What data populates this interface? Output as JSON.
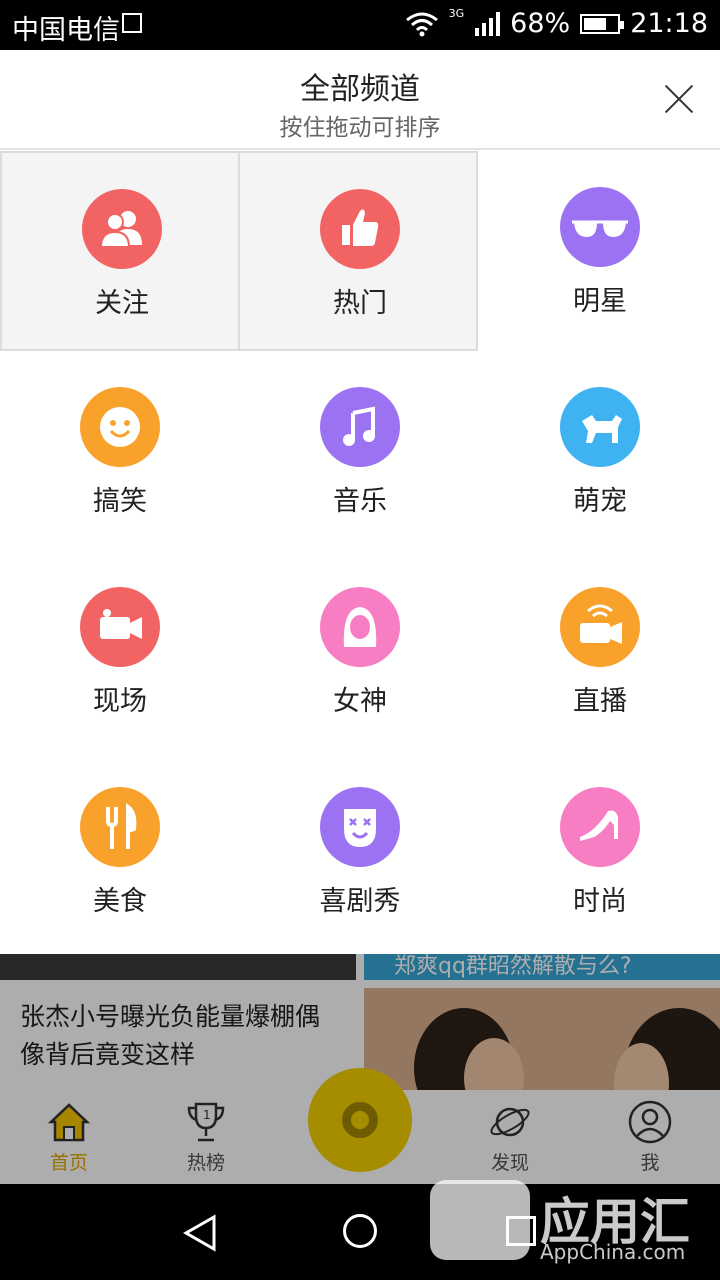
{
  "status_bar": {
    "carrier": "中国电信",
    "network": "3G",
    "battery": "68%",
    "battery_level": 0.68,
    "time": "21:18"
  },
  "panel": {
    "title": "全部频道",
    "subtitle": "按住拖动可排序"
  },
  "channels": [
    {
      "label": "关注",
      "icon": "users-icon",
      "color": "#f26464",
      "selected": true
    },
    {
      "label": "热门",
      "icon": "thumbs-up-icon",
      "color": "#f26464",
      "selected": true
    },
    {
      "label": "明星",
      "icon": "sunglasses-icon",
      "color": "#9b72f2",
      "selected": false
    },
    {
      "label": "搞笑",
      "icon": "smiley-icon",
      "color": "#f9a22b",
      "selected": false
    },
    {
      "label": "音乐",
      "icon": "music-note-icon",
      "color": "#9b72f2",
      "selected": false
    },
    {
      "label": "萌宠",
      "icon": "dog-icon",
      "color": "#3fb2f2",
      "selected": false
    },
    {
      "label": "现场",
      "icon": "video-camera-icon",
      "color": "#f26464",
      "selected": false
    },
    {
      "label": "女神",
      "icon": "woman-icon",
      "color": "#f77ec3",
      "selected": false
    },
    {
      "label": "直播",
      "icon": "live-camera-icon",
      "color": "#f9a22b",
      "selected": false
    },
    {
      "label": "美食",
      "icon": "fork-knife-icon",
      "color": "#f9a22b",
      "selected": false
    },
    {
      "label": "喜剧秀",
      "icon": "clown-mask-icon",
      "color": "#9b72f2",
      "selected": false
    },
    {
      "label": "时尚",
      "icon": "high-heel-icon",
      "color": "#f77ec3",
      "selected": false
    }
  ],
  "background": {
    "banner_text": "郑爽qq群昭然解散与么?",
    "news_title": "张杰小号曝光负能量爆棚偶像背后竟变这样"
  },
  "tabbar": {
    "tabs": [
      {
        "label": "首页",
        "icon": "home-icon"
      },
      {
        "label": "热榜",
        "icon": "trophy-icon"
      },
      {
        "label": "发现",
        "icon": "planet-icon"
      },
      {
        "label": "我",
        "icon": "profile-icon"
      }
    ]
  },
  "watermark": {
    "text": "应用汇",
    "domain": "AppChina.com"
  }
}
